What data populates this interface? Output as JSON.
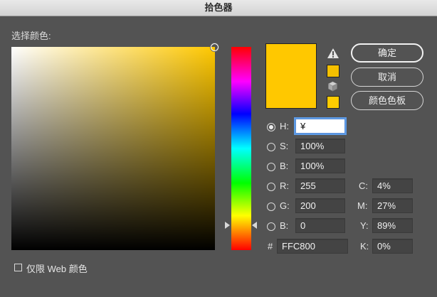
{
  "window": {
    "title": "拾色器"
  },
  "picker": {
    "label": "选择颜色:"
  },
  "colors": {
    "current": "#ffc800",
    "gamut_swatch": "#f5c000",
    "web_swatch": "#ffcc00",
    "accent": "#5d9be6"
  },
  "buttons": {
    "ok": "确定",
    "cancel": "取消",
    "swatches": "颜色色板"
  },
  "hsb": {
    "h": {
      "label": "H:",
      "value": "¥"
    },
    "s": {
      "label": "S:",
      "value": "100%"
    },
    "b": {
      "label": "B:",
      "value": "100%"
    }
  },
  "rgb": {
    "r": {
      "label": "R:",
      "value": "255"
    },
    "g": {
      "label": "G:",
      "value": "200"
    },
    "b": {
      "label": "B:",
      "value": "0"
    }
  },
  "hex": {
    "label": "#",
    "value": "FFC800"
  },
  "cmyk": {
    "c": {
      "label": "C:",
      "value": "4%"
    },
    "m": {
      "label": "M:",
      "value": "27%"
    },
    "y": {
      "label": "Y:",
      "value": "89%"
    },
    "k": {
      "label": "K:",
      "value": "0%"
    }
  },
  "web_only": {
    "label": "仅限 Web 颜色"
  },
  "icons": {
    "warning": "warning-triangle-icon",
    "cube": "cube-icon"
  }
}
